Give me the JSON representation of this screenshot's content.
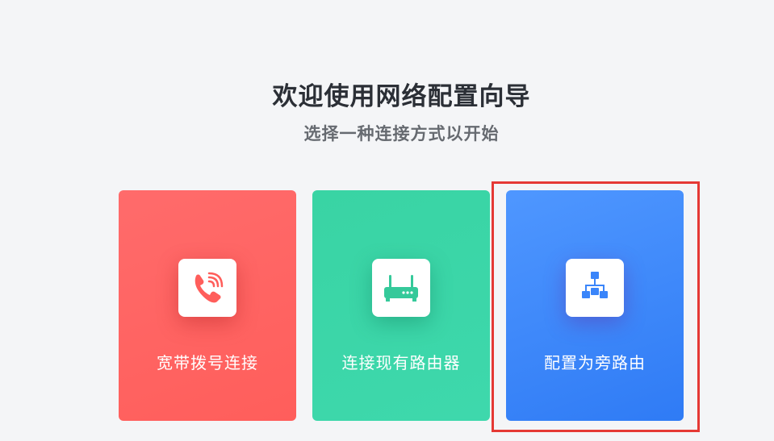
{
  "header": {
    "title": "欢迎使用网络配置向导",
    "subtitle": "选择一种连接方式以开始"
  },
  "options": [
    {
      "label": "宽带拨号连接",
      "icon": "phone-icon",
      "color": "#ff5e5b"
    },
    {
      "label": "连接现有路由器",
      "icon": "router-icon",
      "color": "#3ed8ac"
    },
    {
      "label": "配置为旁路由",
      "icon": "network-tree-icon",
      "color": "#3a85fa"
    }
  ],
  "highlight": {
    "color": "#e53935",
    "target": "配置为旁路由"
  }
}
